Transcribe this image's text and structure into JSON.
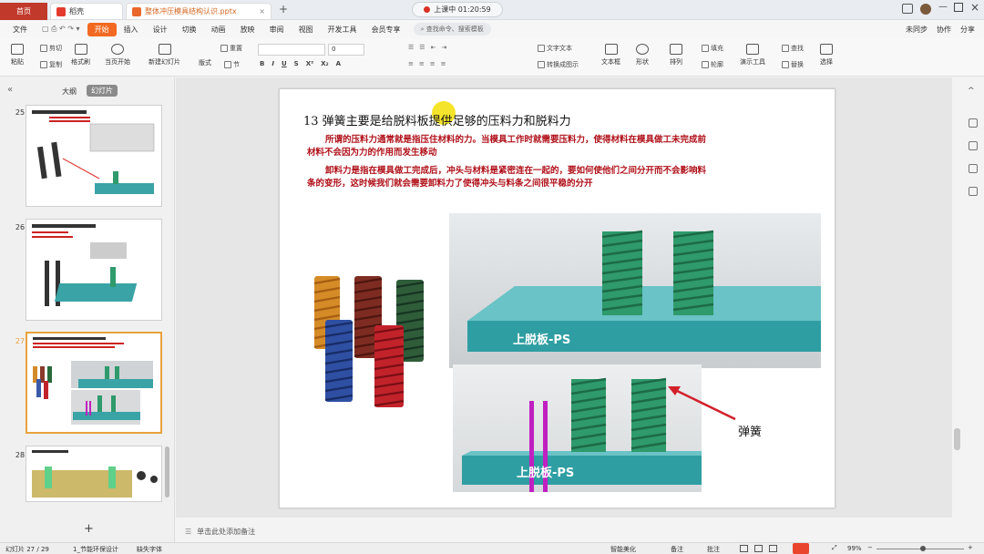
{
  "tabs": {
    "home": "首页",
    "wps": "稻壳",
    "doc": "整体冲压模具结构认识.pptx"
  },
  "recording": {
    "label": "上课中 01:20:59"
  },
  "menubar": {
    "file": "文件",
    "items": [
      "开始",
      "插入",
      "设计",
      "切换",
      "动画",
      "放映",
      "审阅",
      "视图",
      "开发工具",
      "会员专享"
    ],
    "search": "查找命令、搜索模板",
    "right": [
      "未同步",
      "协作",
      "分享"
    ]
  },
  "ribbon": {
    "paste": "粘贴",
    "cut": "剪切",
    "copy": "复制",
    "format_painter": "格式刷",
    "play": "当页开始",
    "new_slide": "新建幻灯片",
    "layout": "版式",
    "section": "节",
    "reset": "重置",
    "font_size": "0",
    "textbox": "文本框",
    "shape": "形状",
    "arrange": "排列",
    "outline": "轮廓",
    "fill": "填充",
    "show_tools": "演示工具",
    "replace": "替换",
    "find": "查找",
    "select": "选择",
    "convert_shape": "转换成图示",
    "text_frame": "文字文本"
  },
  "leftpanel": {
    "view_outline": "大纲",
    "view_slides": "幻灯片",
    "thumbnails": [
      {
        "num": "25",
        "title": "13号装板 在闭合时描述"
      },
      {
        "num": "26",
        "title": "12 带头顶料销"
      },
      {
        "num": "27",
        "title": "13 弹簧主要是给脱料板提供足够的压料力和脱料力"
      },
      {
        "num": "28",
        "title": "14 ..."
      }
    ],
    "add": "+"
  },
  "slide": {
    "title": "13  弹簧主要是给脱料板提供足够的压料力和脱料力",
    "para1_line1": "所谓的压料力通常就是指压住材料的力。当模具工作时就需要压料力，使得材料在模具做工未完成前",
    "para1_line2": "材料不会因为力的作用而发生移动",
    "para2_line1": "卸料力是指在模具做工完成后，冲头与材料是紧密连在一起的，要如何使他们之间分开而不会影响料",
    "para2_line2": "条的变形，这时候我们就会需要卸料力了使得冲头与料条之间很平稳的分开",
    "label_top": "上脱板-PS",
    "label_bottom": "上脱板-PS",
    "label_spring": "弹簧"
  },
  "notes": {
    "placeholder": "单击此处添加备注"
  },
  "status": {
    "slide_count": "幻灯片 27 / 29",
    "theme": "1_节能环保设计",
    "font_missing": "缺失字体",
    "smart": "智能美化",
    "notes": "备注",
    "comment": "批注",
    "zoom": "99%"
  },
  "colors": {
    "accent": "#f26a21",
    "home_tab": "#c0392b",
    "slide_text_red": "#b0111a",
    "plate": "#3aa3a6",
    "spring_green": "#2f9a6b"
  }
}
